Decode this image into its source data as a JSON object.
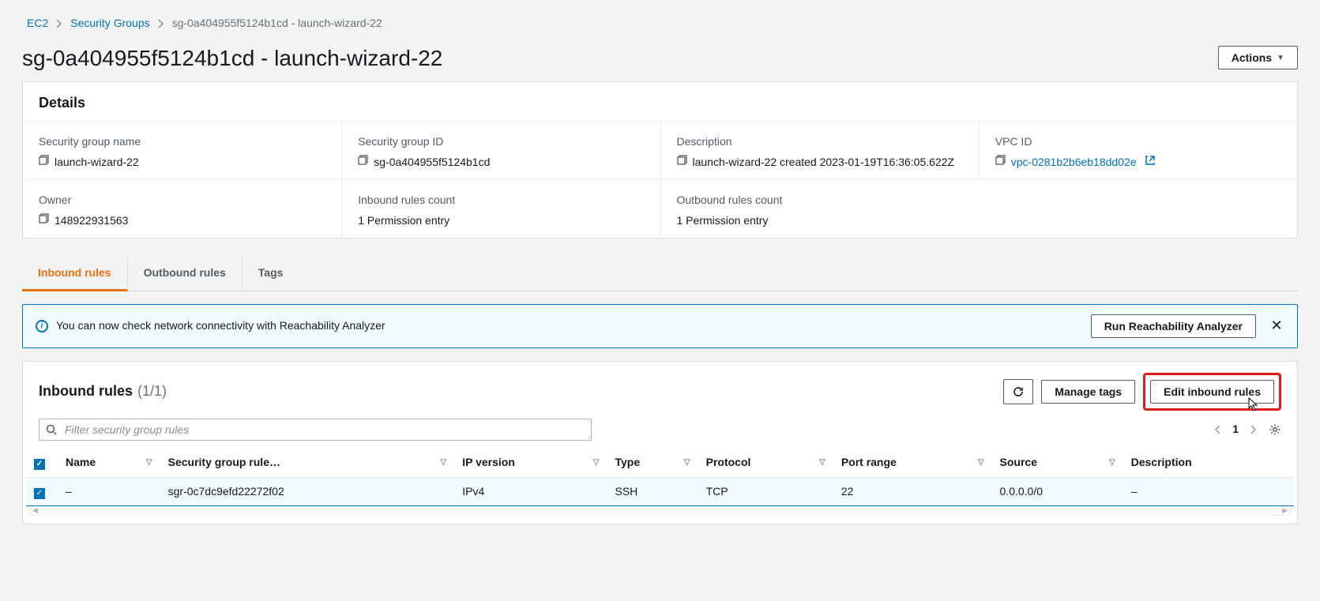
{
  "breadcrumbs": {
    "items": [
      "EC2",
      "Security Groups"
    ],
    "current": "sg-0a404955f5124b1cd - launch-wizard-22"
  },
  "title": "sg-0a404955f5124b1cd - launch-wizard-22",
  "actions_label": "Actions",
  "details": {
    "heading": "Details",
    "items": {
      "sg_name_label": "Security group name",
      "sg_name_value": "launch-wizard-22",
      "sg_id_label": "Security group ID",
      "sg_id_value": "sg-0a404955f5124b1cd",
      "desc_label": "Description",
      "desc_value": "launch-wizard-22 created 2023-01-19T16:36:05.622Z",
      "vpc_label": "VPC ID",
      "vpc_value": "vpc-0281b2b6eb18dd02e",
      "owner_label": "Owner",
      "owner_value": "148922931563",
      "in_count_label": "Inbound rules count",
      "in_count_value": "1 Permission entry",
      "out_count_label": "Outbound rules count",
      "out_count_value": "1 Permission entry"
    }
  },
  "tabs": {
    "inbound": "Inbound rules",
    "outbound": "Outbound rules",
    "tags": "Tags"
  },
  "info_banner": {
    "text": "You can now check network connectivity with Reachability Analyzer",
    "button": "Run Reachability Analyzer"
  },
  "rules": {
    "title": "Inbound rules",
    "count": "(1/1)",
    "manage_tags": "Manage tags",
    "edit": "Edit inbound rules",
    "filter_placeholder": "Filter security group rules",
    "page": "1",
    "columns": {
      "name": "Name",
      "rule_id": "Security group rule…",
      "ip_ver": "IP version",
      "type": "Type",
      "protocol": "Protocol",
      "port": "Port range",
      "source": "Source",
      "desc": "Description"
    },
    "rows": [
      {
        "name": "–",
        "rule_id": "sgr-0c7dc9efd22272f02",
        "ip_ver": "IPv4",
        "type": "SSH",
        "protocol": "TCP",
        "port": "22",
        "source": "0.0.0.0/0",
        "desc": "–"
      }
    ]
  }
}
